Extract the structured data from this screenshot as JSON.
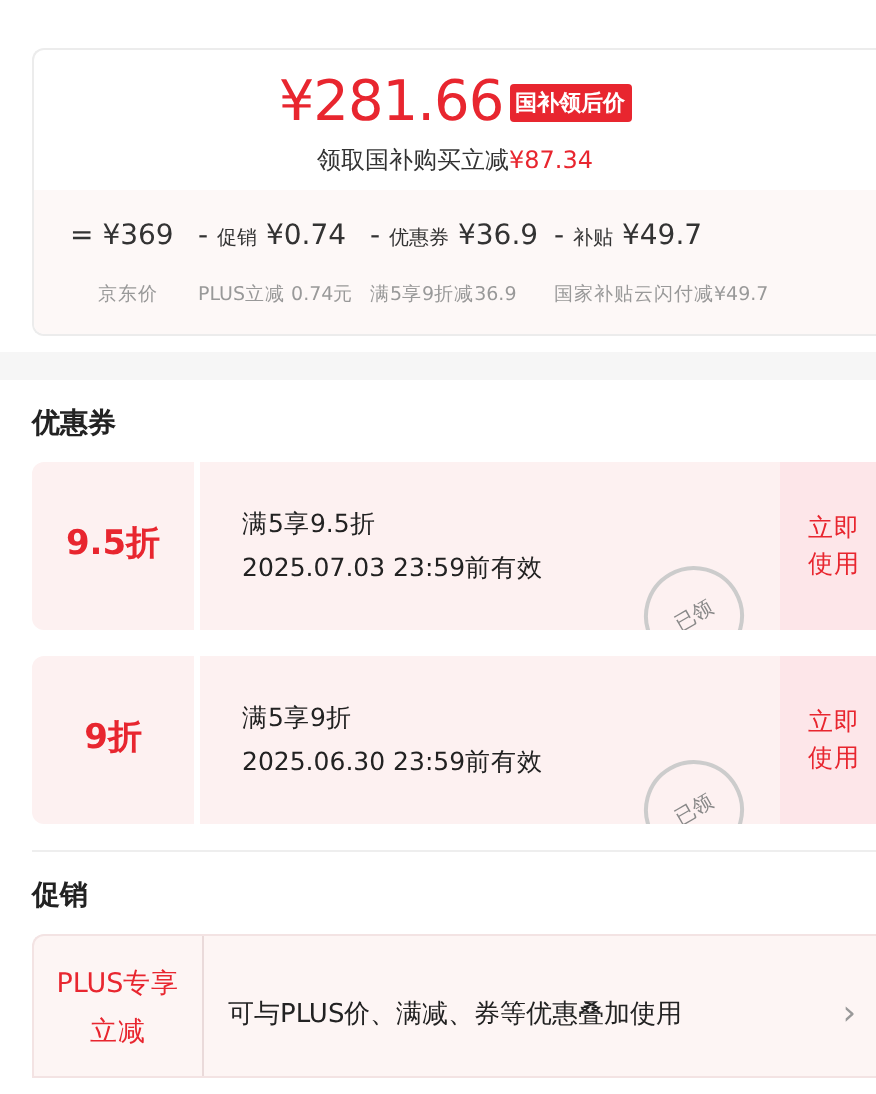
{
  "price_card": {
    "price": "¥281.66",
    "price_tag": "国补领后价",
    "subtitle": "领取国补购买立减",
    "subtitle_amount": "¥87.34",
    "breakdown": [
      {
        "op": "=",
        "amount": "¥369",
        "caption": "京东价"
      },
      {
        "op": "-",
        "label": "促销",
        "amount": "¥0.74",
        "caption": "PLUS立减 0.74元"
      },
      {
        "op": "-",
        "label": "优惠券",
        "amount": "¥36.9",
        "caption": "满5享9折减36.9"
      },
      {
        "op": "-",
        "label": "补贴",
        "amount": "¥49.7",
        "caption": "国家补贴云闪付减¥49.7"
      }
    ]
  },
  "coupons": {
    "title": "优惠券",
    "items": [
      {
        "value": "9.5折",
        "rule": "满5享9.5折",
        "validity": "2025.07.03 23:59前有效",
        "stamp": "已领",
        "action": "立即使用"
      },
      {
        "value": "9折",
        "rule": "满5享9折",
        "validity": "2025.06.30 23:59前有效",
        "stamp": "已领",
        "action": "立即使用"
      }
    ]
  },
  "promotions": {
    "title": "促销",
    "items": [
      {
        "tag": "PLUS专享立减",
        "text": "可与PLUS价、满减、券等优惠叠加使用",
        "chevron": "›"
      }
    ]
  }
}
